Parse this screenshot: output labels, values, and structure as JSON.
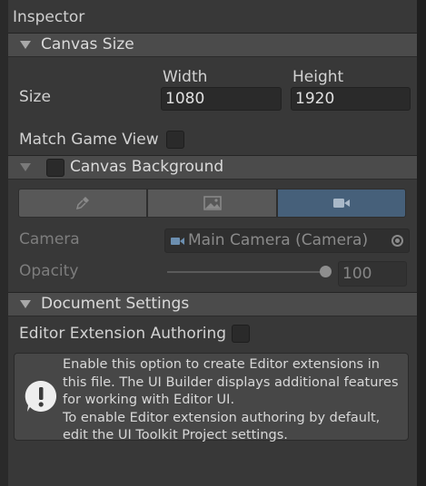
{
  "window": {
    "title": "Inspector"
  },
  "canvas_size": {
    "header": "Canvas Size",
    "size_label": "Size",
    "width_label": "Width",
    "height_label": "Height",
    "width_value": "1080",
    "height_value": "1920",
    "match_game_view_label": "Match Game View",
    "match_game_view_checked": false
  },
  "canvas_background": {
    "header": "Canvas Background",
    "enabled": false,
    "modes": [
      {
        "icon": "color-picker-icon",
        "selected": false
      },
      {
        "icon": "image-icon",
        "selected": false
      },
      {
        "icon": "camera-icon",
        "selected": true
      }
    ],
    "camera_label": "Camera",
    "camera_value": "Main Camera (Camera)",
    "opacity_label": "Opacity",
    "opacity_value": "100",
    "opacity_fraction": 1.0
  },
  "document_settings": {
    "header": "Document Settings",
    "editor_extension_label": "Editor Extension Authoring",
    "editor_extension_checked": false,
    "help_message": "Enable this option to create Editor extensions in this file. The UI Builder displays additional features for working with Editor UI.\nTo enable Editor extension authoring by default, edit the UI Toolkit Project settings."
  },
  "colors": {
    "accent_selected": "#46607a",
    "panel_bg": "#383838",
    "header_bg": "#4b4b4b"
  }
}
